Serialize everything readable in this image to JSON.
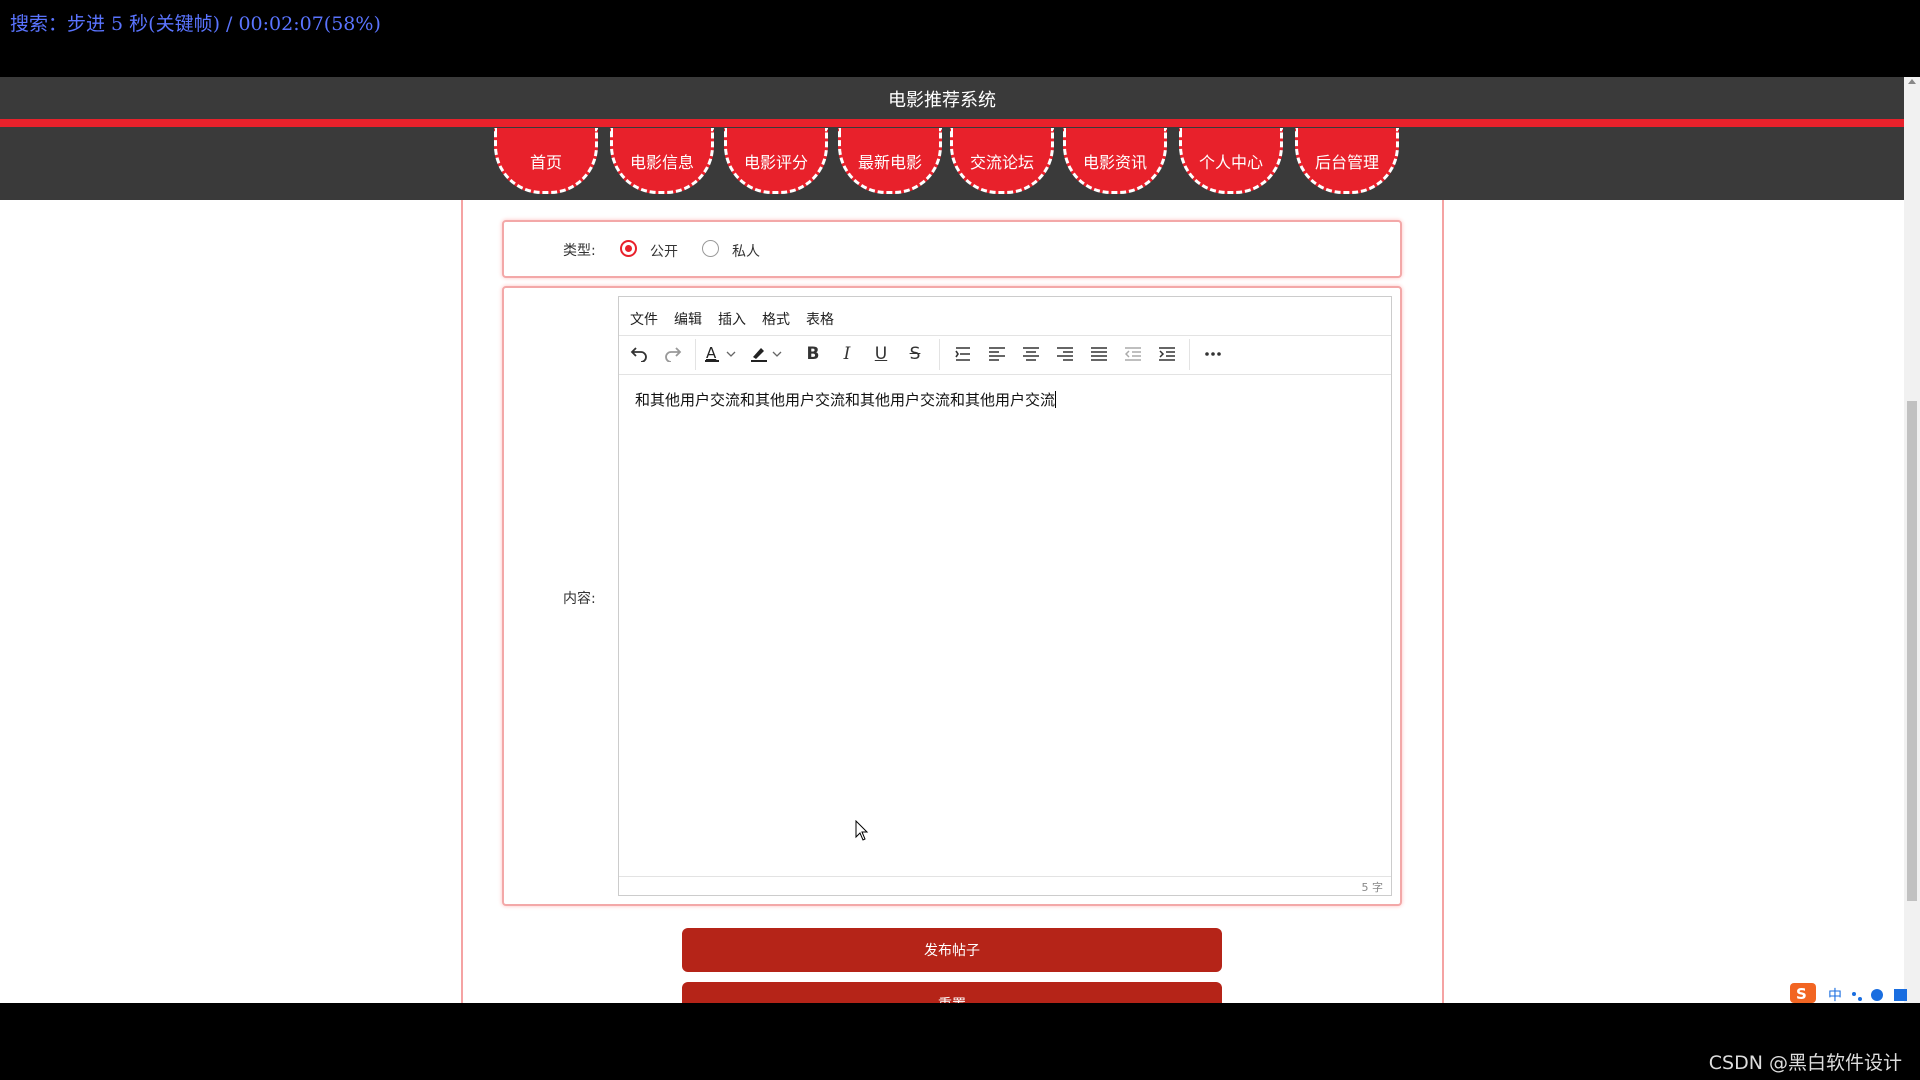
{
  "osd": {
    "text": "搜索：步进 5 秒(关键帧) / 00:02:07(58%)"
  },
  "header": {
    "title": "电影推荐系统"
  },
  "nav": {
    "items": [
      "首页",
      "电影信息",
      "电影评分",
      "最新电影",
      "交流论坛",
      "电影资讯",
      "个人中心",
      "后台管理"
    ]
  },
  "form": {
    "type_label": "类型:",
    "type_options": [
      "公开",
      "私人"
    ],
    "type_selected": "公开",
    "content_label": "内容:"
  },
  "editor": {
    "menu": [
      "文件",
      "编辑",
      "插入",
      "格式",
      "表格"
    ],
    "toolbar_icons": [
      "undo-icon",
      "redo-icon",
      "text-color-icon",
      "highlight-color-icon",
      "bold-icon",
      "italic-icon",
      "underline-icon",
      "strikethrough-icon",
      "line-height-icon",
      "align-left-icon",
      "align-center-icon",
      "align-right-icon",
      "align-justify-icon",
      "outdent-icon",
      "indent-icon",
      "more-icon"
    ],
    "content": "和其他用户交流和其他用户交流和其他用户交流和其他用户交流",
    "word_count": "5 字"
  },
  "buttons": {
    "publish": "发布帖子",
    "reset": "重置"
  },
  "watermark": "CSDN @黑白软件设计",
  "colors": {
    "accent": "#e8212b",
    "header_bg": "#3a3a3a",
    "button": "#b52418"
  }
}
